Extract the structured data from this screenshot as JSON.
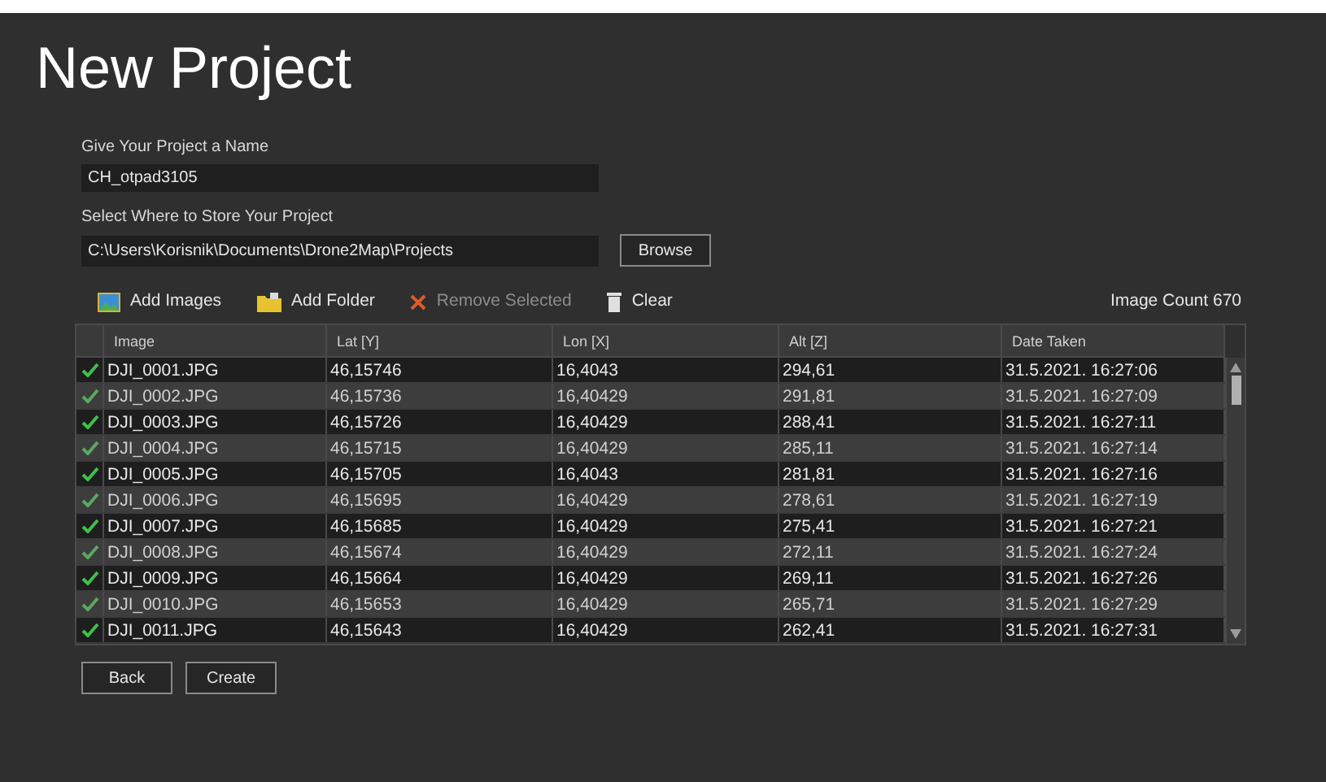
{
  "title": "New Project",
  "name_label": "Give Your Project a Name",
  "name_field": {
    "value": "CH_otpad3105"
  },
  "location_label": "Select Where to Store Your Project",
  "location_field": {
    "value": "C:\\Users\\Korisnik\\Documents\\Drone2Map\\Projects"
  },
  "browse_button": "Browse",
  "toolbar": [
    {
      "kind": "images",
      "label": "Add Images",
      "disabled": false
    },
    {
      "kind": "folder",
      "label": "Add Folder",
      "disabled": false
    },
    {
      "kind": "remove",
      "label": "Remove Selected",
      "disabled": true
    },
    {
      "kind": "clear",
      "label": "Clear",
      "disabled": false
    }
  ],
  "image_count": "Image Count 670",
  "table": {
    "columns": [
      "Image",
      "Lat [Y]",
      "Lon [X]",
      "Alt [Z]",
      "Date Taken"
    ],
    "rows": [
      {
        "checked": true,
        "cells": [
          "DJI_0001.JPG",
          "46,15746",
          "16,4043",
          "294,61",
          "31.5.2021. 16:27:06"
        ]
      },
      {
        "checked": true,
        "cells": [
          "DJI_0002.JPG",
          "46,15736",
          "16,40429",
          "291,81",
          "31.5.2021. 16:27:09"
        ]
      },
      {
        "checked": true,
        "cells": [
          "DJI_0003.JPG",
          "46,15726",
          "16,40429",
          "288,41",
          "31.5.2021. 16:27:11"
        ]
      },
      {
        "checked": true,
        "cells": [
          "DJI_0004.JPG",
          "46,15715",
          "16,40429",
          "285,11",
          "31.5.2021. 16:27:14"
        ]
      },
      {
        "checked": true,
        "cells": [
          "DJI_0005.JPG",
          "46,15705",
          "16,4043",
          "281,81",
          "31.5.2021. 16:27:16"
        ]
      },
      {
        "checked": true,
        "cells": [
          "DJI_0006.JPG",
          "46,15695",
          "16,40429",
          "278,61",
          "31.5.2021. 16:27:19"
        ]
      },
      {
        "checked": true,
        "cells": [
          "DJI_0007.JPG",
          "46,15685",
          "16,40429",
          "275,41",
          "31.5.2021. 16:27:21"
        ]
      },
      {
        "checked": true,
        "cells": [
          "DJI_0008.JPG",
          "46,15674",
          "16,40429",
          "272,11",
          "31.5.2021. 16:27:24"
        ]
      },
      {
        "checked": true,
        "cells": [
          "DJI_0009.JPG",
          "46,15664",
          "16,40429",
          "269,11",
          "31.5.2021. 16:27:26"
        ]
      },
      {
        "checked": true,
        "cells": [
          "DJI_0010.JPG",
          "46,15653",
          "16,40429",
          "265,71",
          "31.5.2021. 16:27:29"
        ]
      },
      {
        "checked": true,
        "cells": [
          "DJI_0011.JPG",
          "46,15643",
          "16,40429",
          "262,41",
          "31.5.2021. 16:27:31"
        ]
      }
    ]
  },
  "footer_buttons": [
    "Back",
    "Create"
  ]
}
